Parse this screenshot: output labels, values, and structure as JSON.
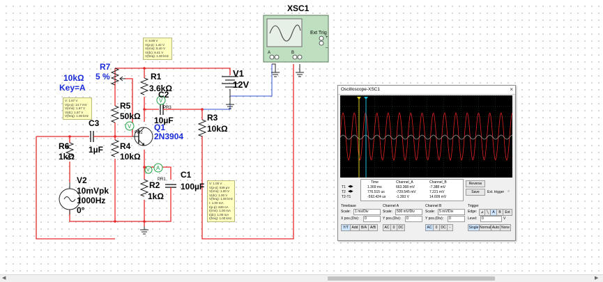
{
  "schematic": {
    "xsc1_label": "XSC1",
    "ext_trig": "Ext Trig",
    "port_a": "A",
    "port_b": "B",
    "plus": "+",
    "minus": "_",
    "r7_name": "R7",
    "r7_pct": "5 %",
    "r7_value": "10kΩ",
    "r7_key": "Key=A",
    "r1_name": "R1",
    "r1_value": "3.6kΩ",
    "r5_name": "R5",
    "r5_value": "50kΩ",
    "c2_name": "C2",
    "c2_value": "10µF",
    "c3_name": "C3",
    "c3_value": "1µF",
    "r6_name": "R6",
    "r6_value": "1kΩ",
    "r4_name": "R4",
    "r4_value": "10kΩ",
    "r3_name": "R3",
    "r3_value": "10kΩ",
    "q1_name": "Q1",
    "q1_model": "2N3904",
    "v1_name": "V1",
    "v1_value": "12V",
    "v2_name": "V2",
    "v2_amp": "10mVpk",
    "v2_freq": "1000Hz",
    "v2_phase": "0°",
    "r2_name": "R2",
    "r2_value": "1kΩ",
    "c1_name": "C1",
    "c1_value": "100µF",
    "pr1": "PR1",
    "pr2": "PR2",
    "pr3": "PR3",
    "probe_v": "V",
    "probe_a": "A"
  },
  "probes": {
    "top": [
      "V: 8.89 V",
      "V(p-p): 1.42 V",
      "V(rms): 8.40 V",
      "V(dc): 8.41 V",
      "V(freq): 1.00 kHz"
    ],
    "left": [
      "V: 1.67 V",
      "V(p-p): 14.7 mV",
      "V(rms): 1.67 V",
      "V(dc): 1.67 V",
      "V(freq): 1.00 kHz"
    ],
    "bottom": [
      "V: 1.00 V",
      "V(p-p): 849 µV",
      "V(rms): 1.00 V",
      "V(dc): 1.00 V",
      "V(freq): 1.00 kHz",
      "I: 1.00 mA",
      "I(p-p): 849 nA",
      "I(rms): 1.00 mA",
      "I(dc): 1.00 mA",
      "I(freq): 1.00 kHz"
    ]
  },
  "oscilloscope": {
    "title": "Oscilloscope-XSC1",
    "close": "×",
    "row_labels": [
      "T1",
      "T2",
      "T2-T1"
    ],
    "col_time": "Time",
    "col_a": "Channel_A",
    "col_b": "Channel_B",
    "t1": [
      "1.369 ms",
      "663.368 mV",
      "-7.388 mV"
    ],
    "t2": [
      "776.515 us",
      "-729.545 mV",
      "7.221 mV"
    ],
    "t21": [
      "-592.424 us",
      "-1.393 V",
      "14.609 mV"
    ],
    "reverse": "Reverse",
    "save": "Save",
    "ext_trigger": "Ext. trigger",
    "timebase_hdr": "Timebase",
    "cha_hdr": "Channel A",
    "chb_hdr": "Channel B",
    "trigger_hdr": "Trigger",
    "scale": "Scale:",
    "timebase_scale": "1 ms/Div",
    "cha_scale": "500 mV/Div",
    "chb_scale": "5 mV/Div",
    "xpos": "X pos.(Div):",
    "ypos": "Y pos.(Div):",
    "xpos_val": "0",
    "ypos_a_val": "0",
    "ypos_b_val": "0",
    "edge": "Edge:",
    "level": "Level:",
    "level_val": "0",
    "level_unit": "V",
    "edge_a": "A",
    "edge_b": "B",
    "edge_ext": "Ext",
    "mode_yt": "Y/T",
    "mode_add": "Add",
    "mode_ba": "B/A",
    "mode_ab": "A/B",
    "ac": "AC",
    "zero": "0",
    "dc": "DC",
    "minus": "-",
    "single": "Single",
    "normal": "Normal",
    "auto": "Auto",
    "none": "None",
    "colors": {
      "channel_a": "#e02020",
      "channel_b": "#9a9a9a",
      "cursor_t1": "#e0d020",
      "cursor_t2": "#20c0e0"
    }
  },
  "colors": {
    "wire": "#e8282a",
    "label_blue": "#1a2bd8",
    "probe_green": "#1aa040"
  }
}
